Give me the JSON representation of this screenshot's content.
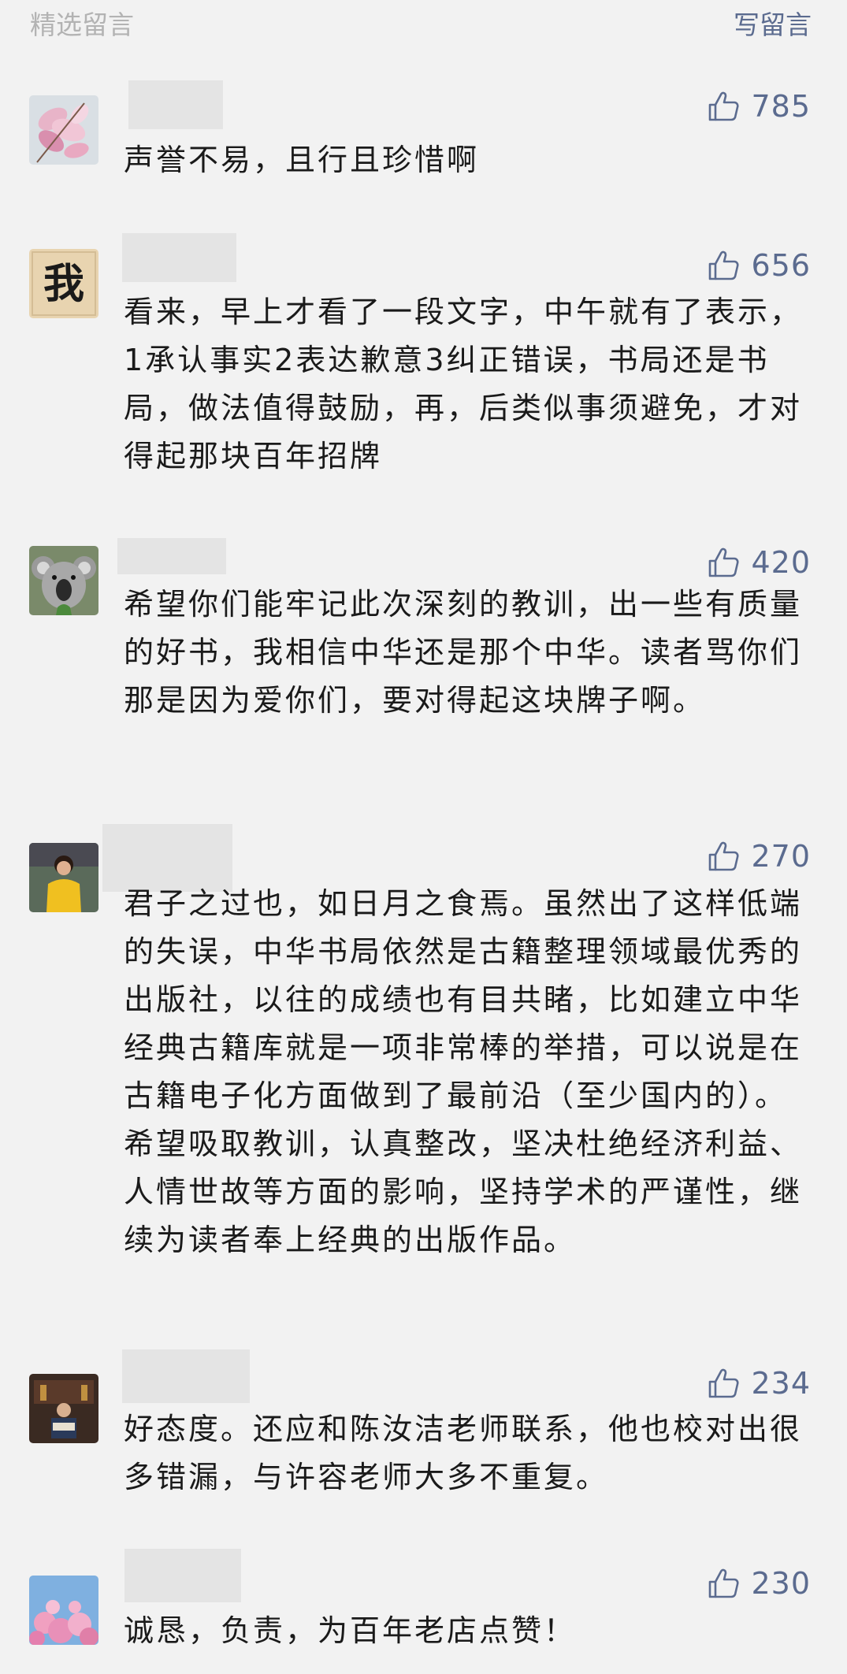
{
  "header": {
    "title": "精选留言",
    "write_label": "写留言"
  },
  "comments": [
    {
      "likes": "785",
      "text": "声誉不易，且行且珍惜啊",
      "avatar": "magnolia-flower"
    },
    {
      "likes": "656",
      "text": "看来，早上才看了一段文字，中午就有了表示，1承认事实2表达歉意3纠正错误，书局还是书局，做法值得鼓励，再，后类似事须避免，才对得起那块百年招牌",
      "avatar": "calligraphy-wo",
      "avatar_char": "我"
    },
    {
      "likes": "420",
      "text": "希望你们能牢记此次深刻的教训，出一些有质量的好书，我相信中华还是那个中华。读者骂你们那是因为爱你们，要对得起这块牌子啊。",
      "avatar": "koala"
    },
    {
      "likes": "270",
      "text": "君子之过也，如日月之食焉。虽然出了这样低端的失误，中华书局依然是古籍整理领域最优秀的出版社，以往的成绩也有目共睹，比如建立中华经典古籍库就是一项非常棒的举措，可以说是在古籍电子化方面做到了最前沿（至少国内的）。希望吸取教训，认真整改，坚决杜绝经济利益、人情世故等方面的影响，坚持学术的严谨性，继续为读者奉上经典的出版作品。",
      "avatar": "person-yellow"
    },
    {
      "likes": "234",
      "text": "好态度。还应和陈汝洁老师联系，他也校对出很多错漏，与许容老师大多不重复。",
      "avatar": "reading-room"
    },
    {
      "likes": "230",
      "text": "诚恳，负责，为百年老店点赞！",
      "avatar": "cherry-blossom"
    }
  ],
  "colors": {
    "background": "#f2f2f2",
    "accent": "#5b6b8f",
    "muted": "#b3b3b3",
    "text": "#1a1a1a"
  }
}
